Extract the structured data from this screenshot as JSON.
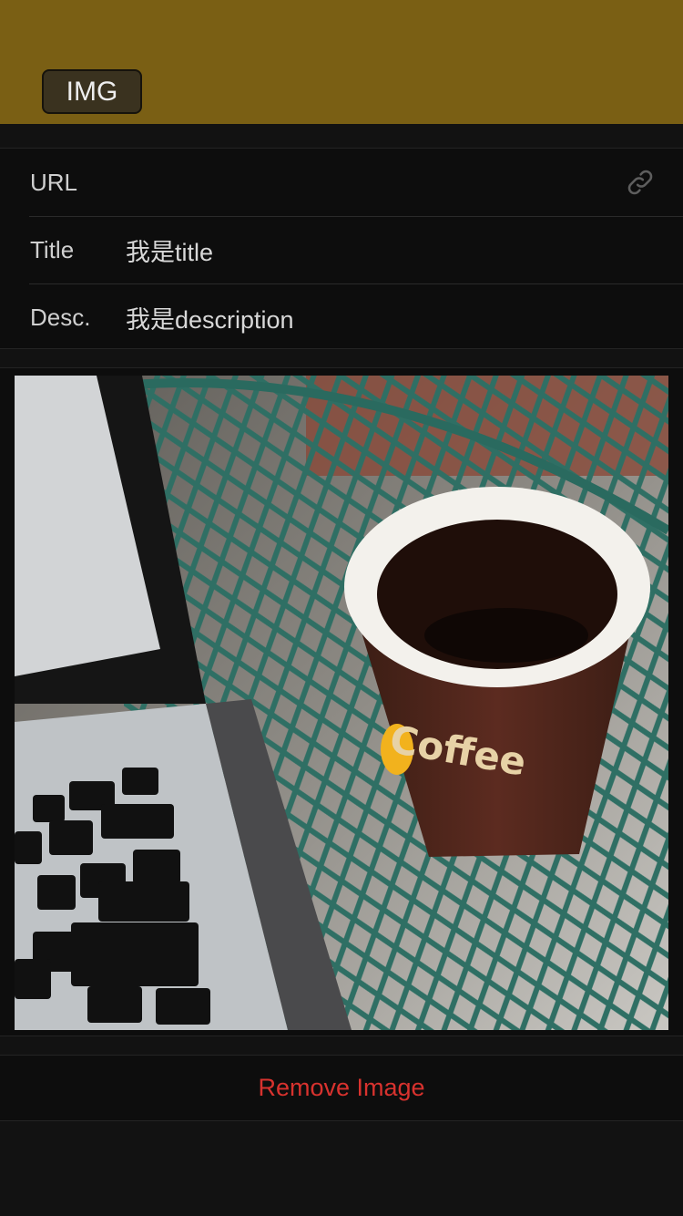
{
  "header": {
    "img_button_label": "IMG",
    "background_color": "#7a5f14"
  },
  "form": {
    "url": {
      "label": "URL",
      "value": "",
      "icon": "link-icon"
    },
    "title": {
      "label": "Title",
      "value": "我是title"
    },
    "desc": {
      "label": "Desc.",
      "value": "我是description"
    }
  },
  "image": {
    "cup_text": "Coffee"
  },
  "actions": {
    "remove_label": "Remove Image",
    "remove_color": "#d8322e"
  }
}
